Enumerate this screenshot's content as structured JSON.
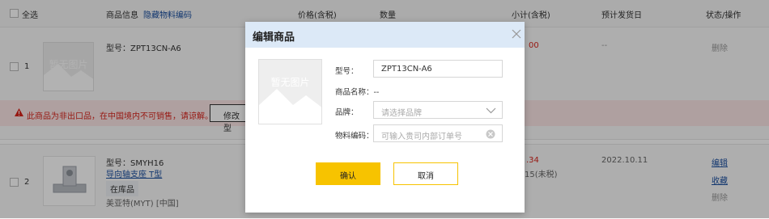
{
  "header": {
    "select_all": "全选",
    "product_info": "商品信息",
    "hide_code": "隐藏物料编码",
    "price": "价格(含税)",
    "quantity": "数量",
    "subtotal": "小计(含税)",
    "est_ship": "预计发货日",
    "status_ops": "状态/操作"
  },
  "rows": [
    {
      "index": "1",
      "no_image": "暂无图片",
      "model": "型号：ZPT13CN-A6",
      "subtotal_partial": "00",
      "ship": "--",
      "delete": "删除",
      "warning": "此商品为非出口品，在中国境内不可销售，请谅解。",
      "modify_button": "修改型"
    },
    {
      "index": "2",
      "model": "型号：SMYH16",
      "name": "导向轴支座 T型",
      "stock": "在库品",
      "brand": "美亚特(MYT) [中国]",
      "subtotal_partial": ".34",
      "subtotal_note_partial": "15(未税)",
      "ship": "2022.10.11",
      "ops": [
        "编辑",
        "收藏",
        "删除"
      ]
    }
  ],
  "dialog": {
    "title": "编辑商品",
    "no_image": "暂无图片",
    "model_label": "型号：",
    "model_value": "ZPT13CN-A6",
    "name_label": "商品名称：--",
    "brand_label": "品牌：",
    "brand_placeholder": "请选择品牌",
    "code_label": "物料编码：",
    "code_placeholder": "可输入贵司内部订单号",
    "confirm": "确认",
    "cancel": "取消"
  },
  "colors": {
    "warning_red": "#d9251c",
    "confirm_yellow": "#f7c300",
    "link_blue": "#1b4fa0"
  }
}
